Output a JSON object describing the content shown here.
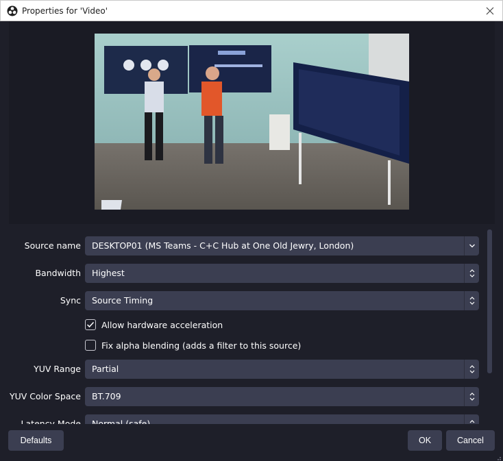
{
  "window": {
    "title": "Properties for 'Video'",
    "app_icon": "obs-logo-icon",
    "close_icon": "close-icon"
  },
  "form": {
    "source_name": {
      "label": "Source name",
      "value": "DESKTOP01 (MS Teams - C+C Hub at One Old Jewry, London)"
    },
    "bandwidth": {
      "label": "Bandwidth",
      "value": "Highest"
    },
    "sync": {
      "label": "Sync",
      "value": "Source Timing"
    },
    "hw_accel": {
      "label": "Allow hardware acceleration",
      "checked": true
    },
    "alpha_blend": {
      "label": "Fix alpha blending (adds a filter to this source)",
      "checked": false
    },
    "yuv_range": {
      "label": "YUV Range",
      "value": "Partial"
    },
    "yuv_color_space": {
      "label": "YUV Color Space",
      "value": "BT.709"
    },
    "latency_mode": {
      "label": "Latency Mode",
      "value": "Normal (safe)"
    }
  },
  "buttons": {
    "defaults": "Defaults",
    "ok": "OK",
    "cancel": "Cancel"
  },
  "colors": {
    "background": "#1e1f29",
    "control": "#3b3e51",
    "text": "#ffffff"
  }
}
